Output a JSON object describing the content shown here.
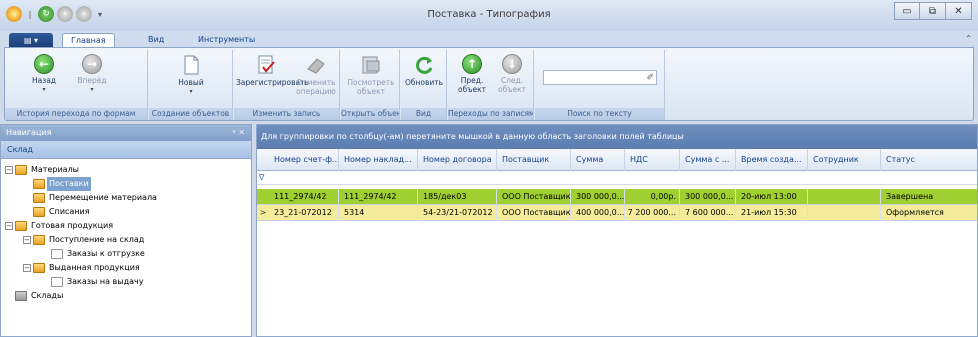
{
  "window": {
    "title": "Поставка - Типография"
  },
  "ribbon_tabs": [
    {
      "label": "Главная",
      "active": true
    },
    {
      "label": "Вид",
      "active": false
    },
    {
      "label": "Инструменты",
      "active": false
    }
  ],
  "ribbon_groups": {
    "history": {
      "label": "История перехода по формам",
      "back": "Назад",
      "forward": "Вперёд"
    },
    "create": {
      "label": "Создание объектов",
      "new": "Новый"
    },
    "edit": {
      "label": "Изменить запись",
      "register": "Зарегистрировать",
      "cancel_line1": "Отменить",
      "cancel_line2": "операцию"
    },
    "open": {
      "label": "Открыть объект",
      "view_line1": "Посмотреть",
      "view_line2": "объект"
    },
    "view": {
      "label": "Вид",
      "refresh": "Обновить"
    },
    "records": {
      "label": "Переходы по записям",
      "prev_line1": "Пред.",
      "prev_line2": "объект",
      "next_line1": "След.",
      "next_line2": "объект"
    },
    "search": {
      "label": "Поиск по тексту",
      "value": ""
    }
  },
  "navigation": {
    "header": "Навигация",
    "pin": "ᵠ  ✕",
    "section": "Склад",
    "tree": [
      {
        "label": "Материалы",
        "level": 0,
        "expanded": true,
        "selected": false,
        "icon": "folder-icon"
      },
      {
        "label": "Поставки",
        "level": 1,
        "selected": true,
        "icon": "folder-icon"
      },
      {
        "label": "Перемещение материала",
        "level": 1,
        "selected": false,
        "icon": "folder-icon"
      },
      {
        "label": "Списания",
        "level": 1,
        "selected": false,
        "icon": "folder-icon"
      },
      {
        "label": "Готовая продукция",
        "level": 0,
        "expanded": true,
        "selected": false,
        "icon": "folder-icon"
      },
      {
        "label": "Поступление на склад",
        "level": 1,
        "expanded": true,
        "selected": false,
        "icon": "folder-icon"
      },
      {
        "label": "Заказы к отгрузке",
        "level": 2,
        "selected": false,
        "icon": "document-icon"
      },
      {
        "label": "Выданная продукция",
        "level": 1,
        "expanded": true,
        "selected": false,
        "icon": "folder-icon"
      },
      {
        "label": "Заказы на выдачу",
        "level": 2,
        "selected": false,
        "icon": "document-icon"
      },
      {
        "label": "Склады",
        "level": 0,
        "selected": false,
        "icon": "warehouse-icon"
      }
    ]
  },
  "grid": {
    "group_hint": "Для группировки по столбцу(-ам) перетяните мышкой в данную область заголовки полей таблицы",
    "columns": [
      "Номер счет-ф...",
      "Номер наклад...",
      "Номер договора",
      "Поставщик",
      "Сумма",
      "НДС",
      "Сумма с ...",
      "Время созда...",
      "Сотрудник",
      "Статус"
    ],
    "rows": [
      {
        "color": "#9fcf30",
        "indicator": "",
        "cells": [
          "111_2974/42",
          "111_2974/42",
          "185/дек03",
          "ООО Поставщик",
          "300 000,0...",
          "0,00р.",
          "300 000,0...",
          "20-июл 13:00",
          "",
          "Завершена"
        ]
      },
      {
        "color": "#f4ec9a",
        "indicator": ">",
        "cells": [
          "23_21-072012",
          "5314",
          "54-23/21-072012",
          "ООО Поставщик",
          "400 000,0...",
          "7 200 000...",
          "7 600 000...",
          "21-июл 15:30",
          "",
          "Оформляется"
        ]
      }
    ]
  }
}
